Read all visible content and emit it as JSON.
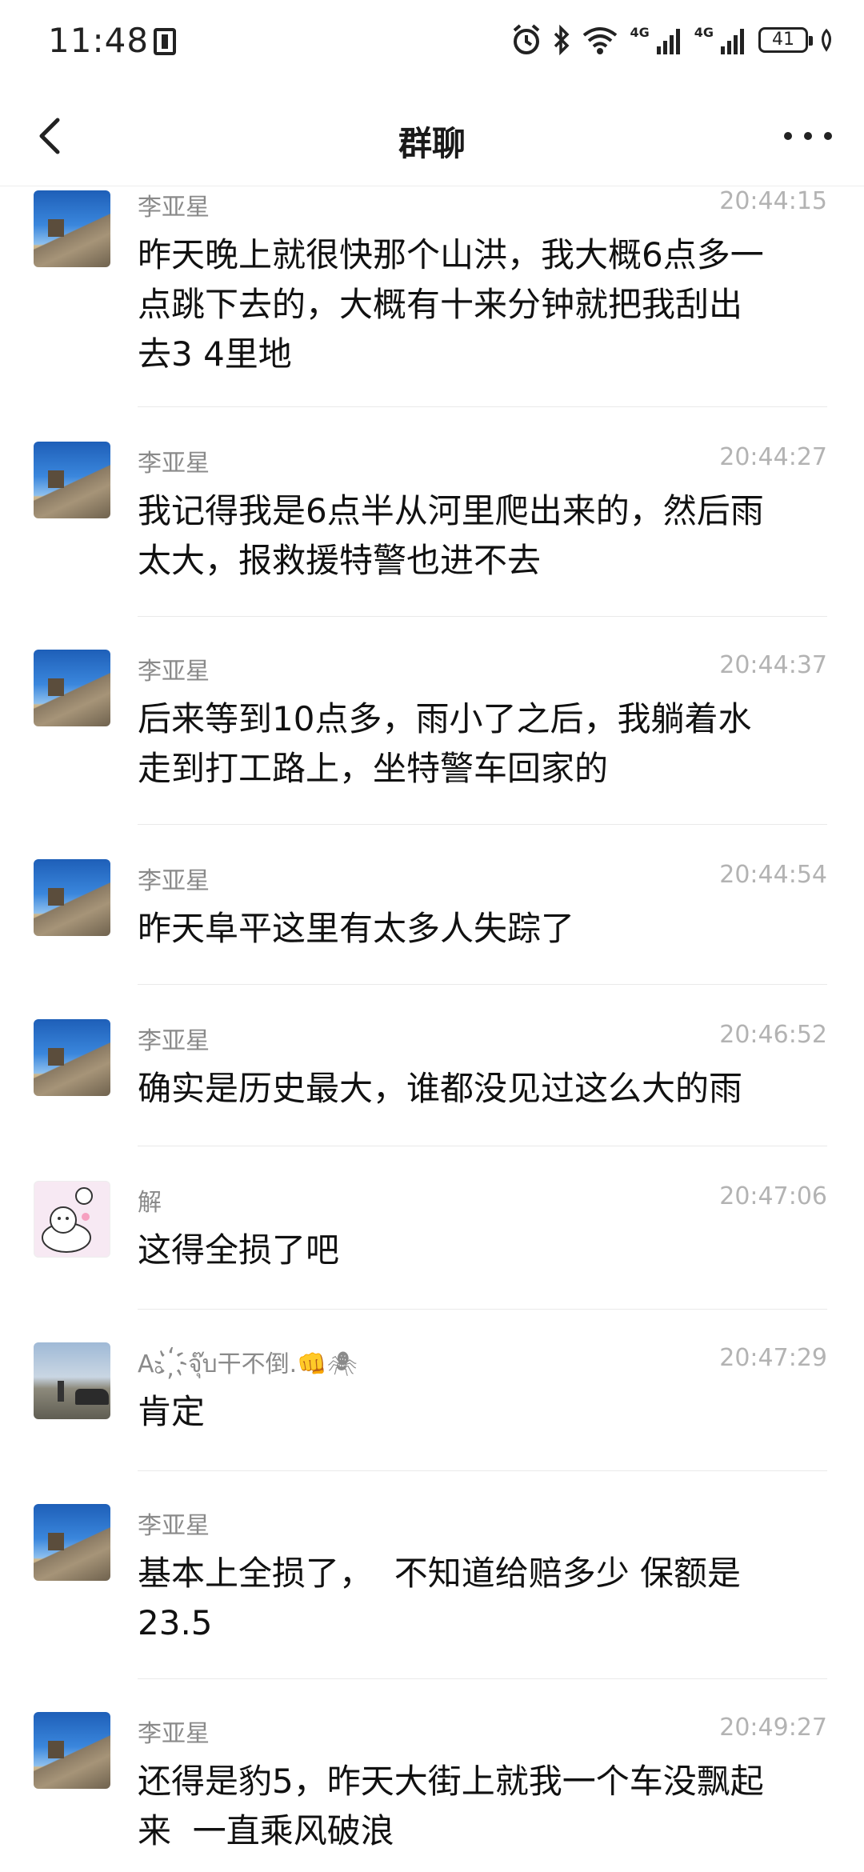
{
  "status_bar": {
    "time": "11:48",
    "net_label_1": "4G",
    "net_label_2": "4G",
    "battery": "41"
  },
  "header": {
    "title": "群聊"
  },
  "messages": [
    {
      "sender": "李亚星",
      "time": "20:44:15",
      "text": "昨天晚上就很快那个山洪，我大概6点多一\n点跳下去的，大概有十来分钟就把我刮出\n去3 4里地",
      "avatar": "great-wall"
    },
    {
      "sender": "李亚星",
      "time": "20:44:27",
      "text": "我记得我是6点半从河里爬出来的，然后雨\n太大，报救援特警也进不去",
      "avatar": "great-wall"
    },
    {
      "sender": "李亚星",
      "time": "20:44:37",
      "text": "后来等到10点多，雨小了之后，我躺着水\n走到打工路上，坐特警车回家的",
      "avatar": "great-wall"
    },
    {
      "sender": "李亚星",
      "time": "20:44:54",
      "text": "昨天阜平这里有太多人失踪了",
      "avatar": "great-wall"
    },
    {
      "sender": "李亚星",
      "time": "20:46:52",
      "text": "确实是历史最大，谁都没见过这么大的雨",
      "avatar": "great-wall"
    },
    {
      "sender": "解",
      "time": "20:47:06",
      "text": "这得全损了吧",
      "avatar": "cartoon-cat"
    },
    {
      "sender": "A。҉จุ๊บ干不倒.👊🕷",
      "time": "20:47:29",
      "text": "肯定",
      "avatar": "photo"
    },
    {
      "sender": "李亚星",
      "time": "",
      "text": "基本上全损了，  不知道给赔多少 保额是\n23.5",
      "avatar": "great-wall"
    },
    {
      "sender": "李亚星",
      "time": "20:49:27",
      "text": "还得是豹5，昨天大街上就我一个车没飘起\n来  一直乘风破浪",
      "avatar": "great-wall"
    }
  ]
}
